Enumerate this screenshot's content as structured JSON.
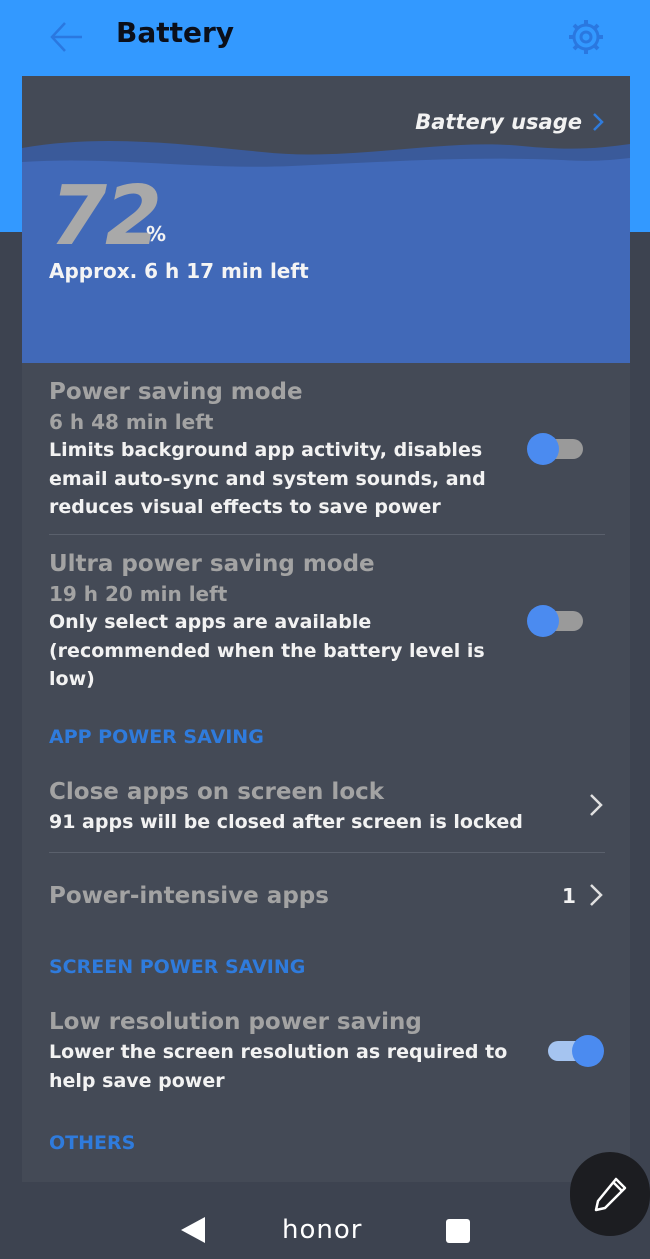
{
  "header": {
    "title": "Battery"
  },
  "hero": {
    "usage_link": "Battery usage",
    "percent_value": "72",
    "percent_sign": "%",
    "time_left": "Approx. 6 h 17 min left"
  },
  "settings": {
    "power_saving": {
      "title": "Power saving mode",
      "time_left": "6 h 48 min left",
      "description": "Limits background app activity, disables email auto-sync and system sounds, and reduces visual effects to save power",
      "enabled": false
    },
    "ultra_power_saving": {
      "title": "Ultra power saving mode",
      "time_left": "19 h 20 min left",
      "description": "Only select apps are available (recommended when the battery level is low)",
      "enabled": false
    },
    "app_power_saving_header": "APP POWER SAVING",
    "close_apps": {
      "title": "Close apps on screen lock",
      "subtitle": "91 apps will be closed after screen is locked"
    },
    "power_intensive": {
      "title": "Power-intensive apps",
      "count": "1"
    },
    "screen_power_saving_header": "SCREEN POWER SAVING",
    "low_res": {
      "title": "Low resolution power saving",
      "description": "Lower the screen resolution as required to help save power",
      "enabled": true
    },
    "others_header": "OTHERS"
  },
  "navbar": {
    "home_label": "honor"
  },
  "colors": {
    "header_bg": "#3399ff",
    "hero_wave": "#4169b8",
    "card_bg": "#444a56",
    "accent": "#2f7bdc",
    "toggle_knob": "#4b8bf0"
  },
  "icons": {
    "back": "back-arrow-icon",
    "settings": "gear-icon",
    "chevron": "chevron-right-icon",
    "nav_back": "triangle-back-icon",
    "nav_recents": "square-recents-icon",
    "fab": "pencil-icon"
  }
}
